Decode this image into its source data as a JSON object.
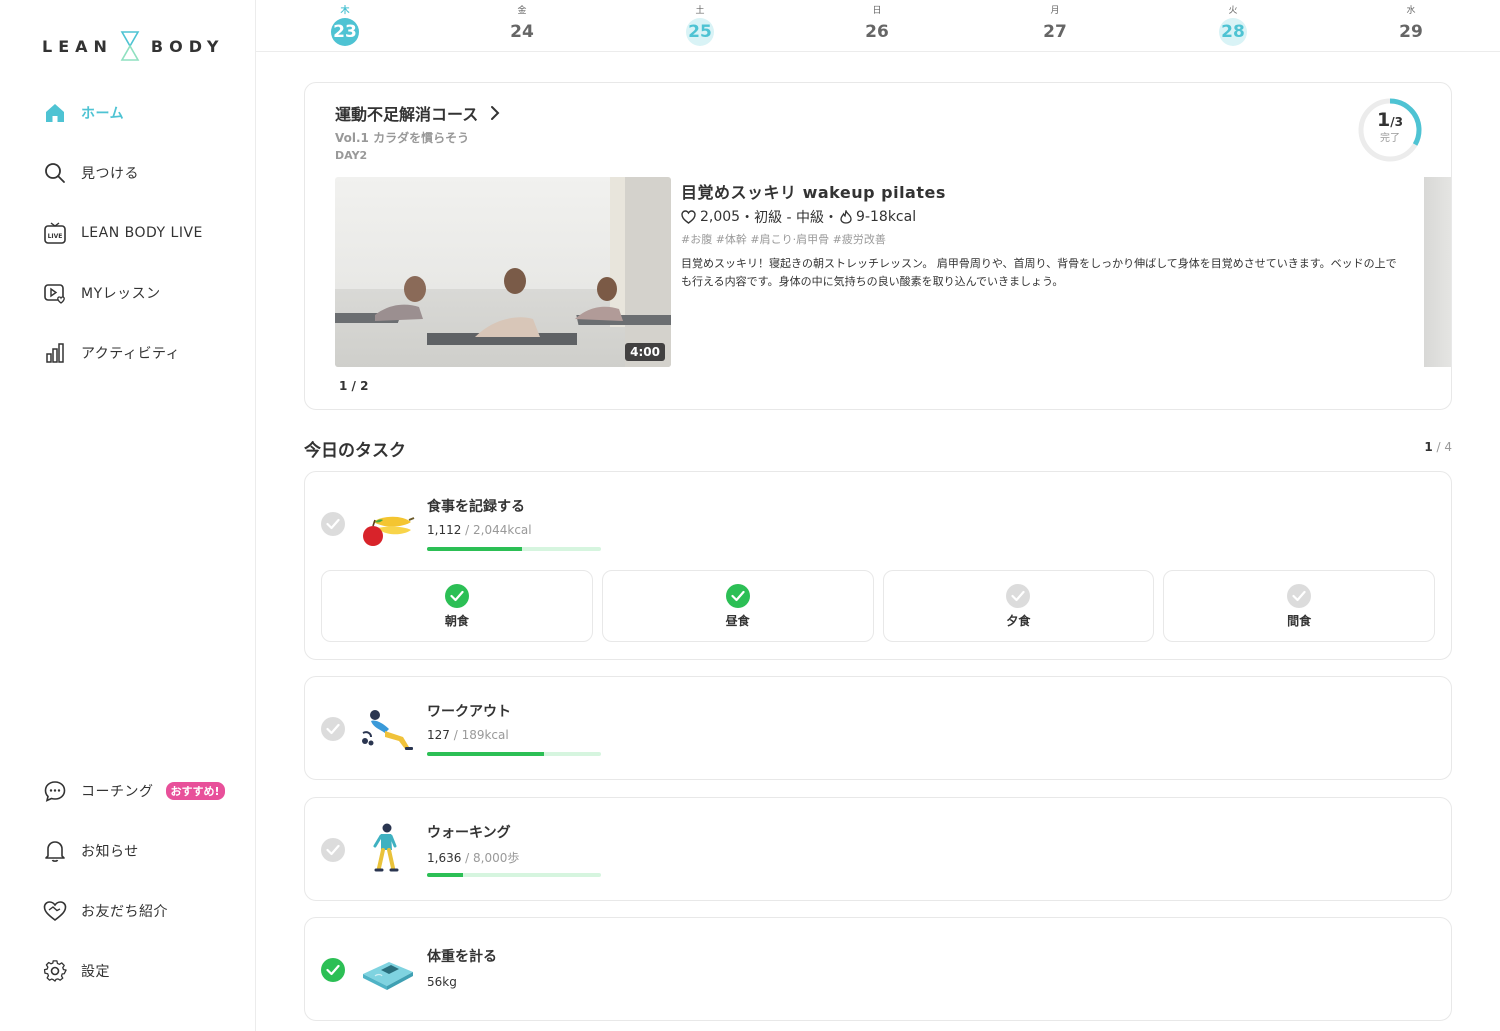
{
  "brand": {
    "left": "LEAN",
    "right": "BODY"
  },
  "sidebar": {
    "items": [
      {
        "label": "ホーム",
        "icon": "home-icon",
        "active": true
      },
      {
        "label": "見つける",
        "icon": "search-icon"
      },
      {
        "label": "LEAN BODY LIVE",
        "icon": "live-tv-icon"
      },
      {
        "label": "MYレッスン",
        "icon": "my-lesson-icon"
      },
      {
        "label": "アクティビティ",
        "icon": "bar-chart-icon"
      }
    ],
    "bottom_items": [
      {
        "label": "コーチング",
        "icon": "chat-bubble-icon",
        "badge": "おすすめ!"
      },
      {
        "label": "お知らせ",
        "icon": "bell-icon"
      },
      {
        "label": "お友だち紹介",
        "icon": "heart-handshake-icon"
      },
      {
        "label": "設定",
        "icon": "gear-icon"
      }
    ]
  },
  "dates": [
    {
      "dow": "木",
      "num": "23",
      "state": "today"
    },
    {
      "dow": "金",
      "num": "24",
      "state": ""
    },
    {
      "dow": "土",
      "num": "25",
      "state": "done"
    },
    {
      "dow": "日",
      "num": "26",
      "state": ""
    },
    {
      "dow": "月",
      "num": "27",
      "state": ""
    },
    {
      "dow": "火",
      "num": "28",
      "state": "done"
    },
    {
      "dow": "水",
      "num": "29",
      "state": ""
    }
  ],
  "course": {
    "title": "運動不足解消コース",
    "volume": "Vol.1 カラダを慣らそう",
    "day": "DAY2",
    "progress_done": "1",
    "progress_total": "/3",
    "progress_fraction": 0.333,
    "progress_label": "完了",
    "pager": "1 / 2",
    "lesson": {
      "title": "目覚めスッキリ wakeup pilates",
      "likes": "2,005",
      "level": "・初級 - 中級・",
      "kcal": "9-18kcal",
      "tags": "#お腹 #体幹 #肩こり·肩甲骨 #疲労改善",
      "description": "目覚めスッキリ！寝起きの朝ストレッチレッスン。 肩甲骨周りや、首周り、背骨をしっかり伸ばして身体を目覚めさせていきます。ベッドの上でも行える内容です。身体の中に気持ちの良い酸素を取り込んでいきましょう。",
      "duration": "4:00"
    }
  },
  "tasks": {
    "heading": "今日のタスク",
    "count_done": "1",
    "count_total": " / 4",
    "items": [
      {
        "name": "食事を記録する",
        "value": "1,112",
        "target": " / 2,044kcal",
        "progress": 0.544,
        "done": false
      },
      {
        "name": "ワークアウト",
        "value": "127",
        "target": " / 189kcal",
        "progress": 0.672,
        "done": false
      },
      {
        "name": "ウォーキング",
        "value": "1,636",
        "target": " / 8,000歩",
        "progress": 0.2045,
        "done": false
      },
      {
        "name": "体重を計る",
        "value": "56kg",
        "target": "",
        "done": true
      }
    ],
    "meals": [
      {
        "label": "朝食",
        "done": true
      },
      {
        "label": "昼食",
        "done": true
      },
      {
        "label": "夕食",
        "done": false
      },
      {
        "label": "間食",
        "done": false
      }
    ]
  },
  "colors": {
    "accent": "#4ec3d3",
    "success": "#2cbf55",
    "badge": "#e8509a"
  }
}
